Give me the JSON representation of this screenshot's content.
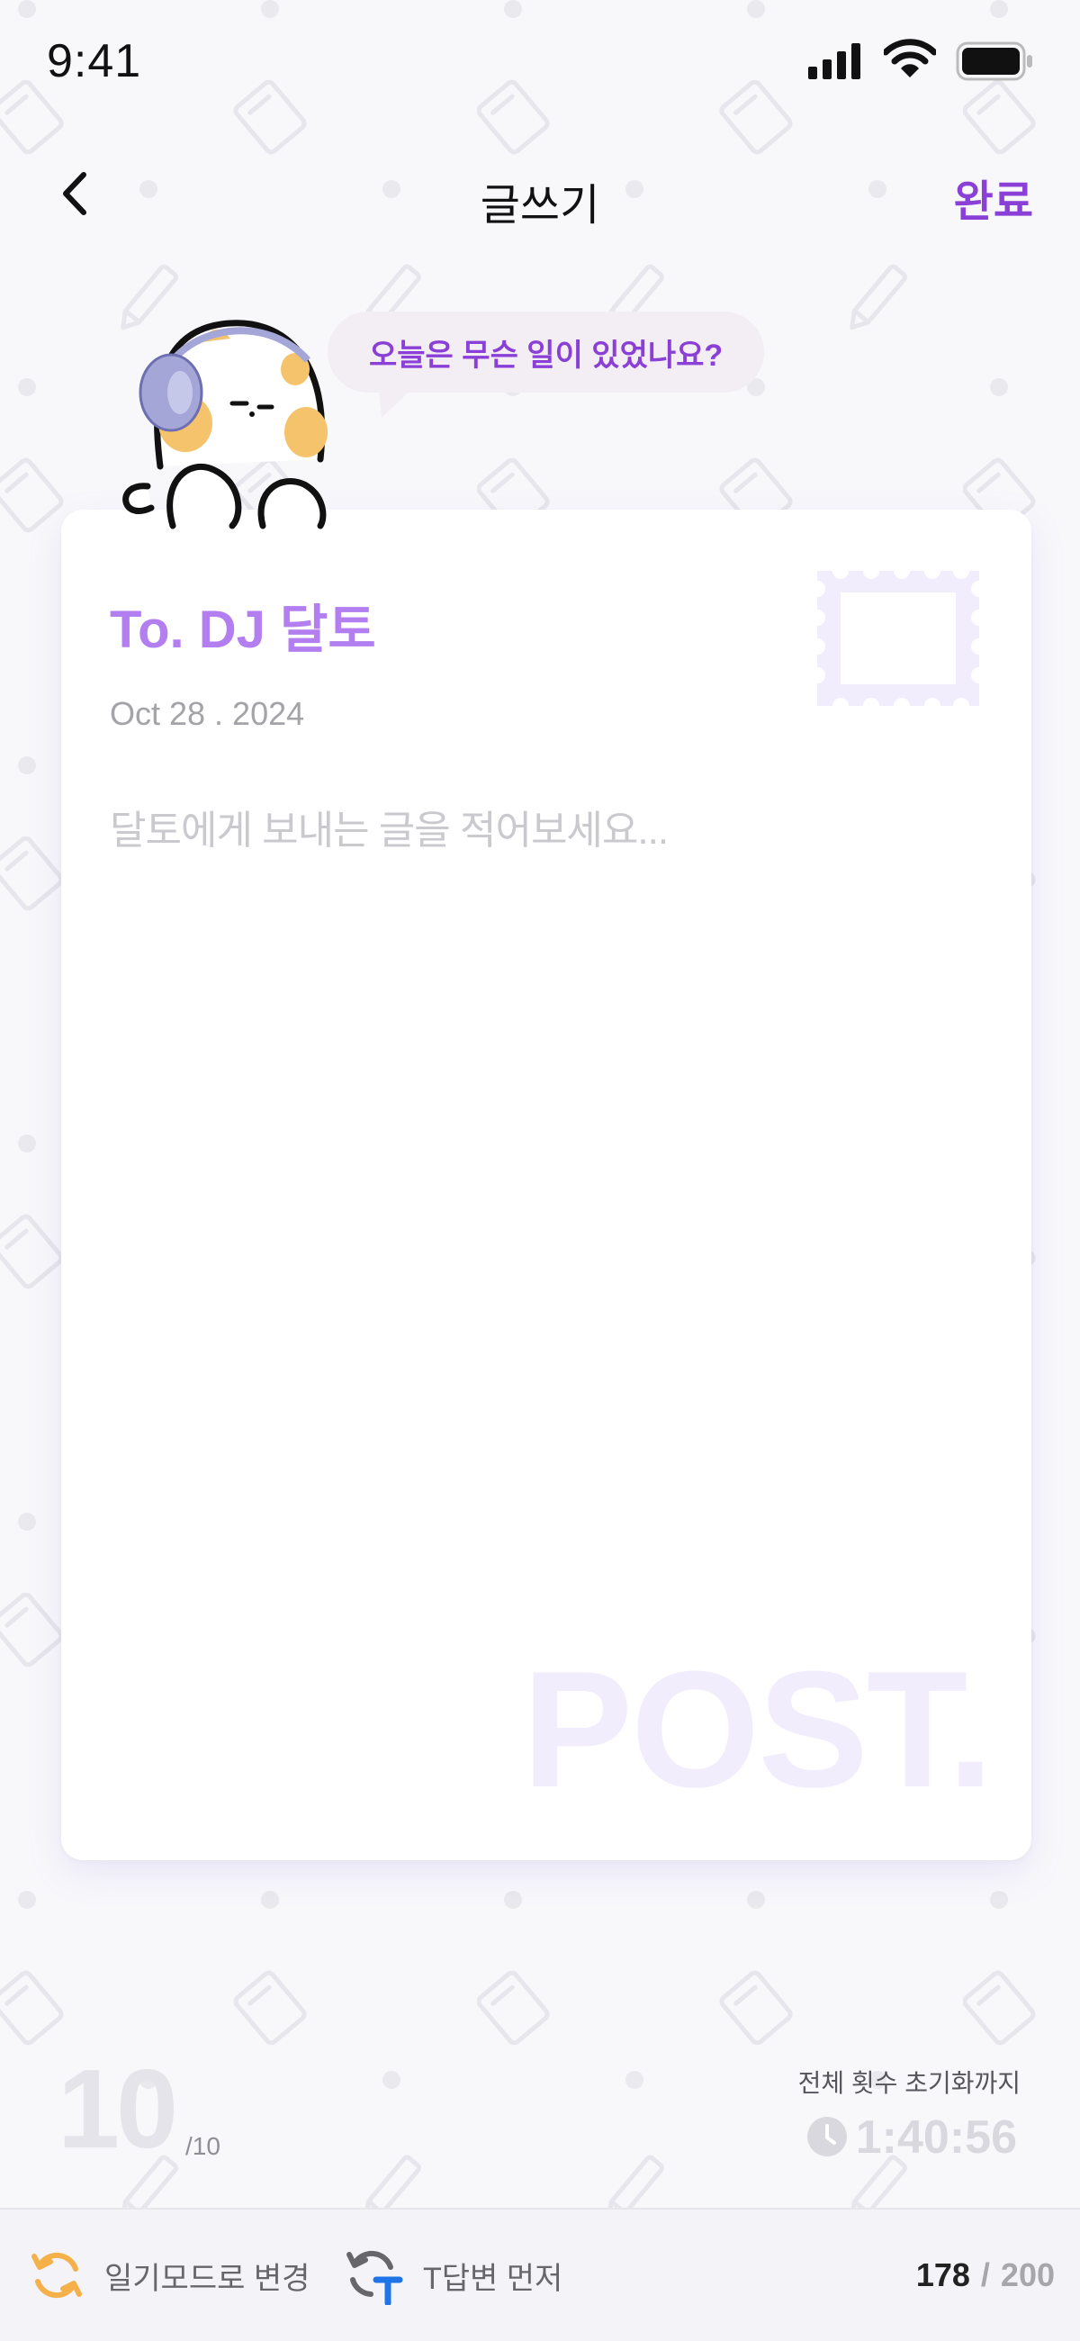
{
  "status_bar": {
    "time": "9:41"
  },
  "header": {
    "title": "글쓰기",
    "done_label": "완료"
  },
  "mascot": {
    "speech": "오늘은 무슨 일이 있었나요?"
  },
  "letter": {
    "recipient": "To. DJ 달토",
    "date": "Oct 28 . 2024",
    "placeholder": "달토에게 보내는 글을 적어보세요...",
    "watermark": "POST."
  },
  "quota": {
    "remaining": "10",
    "total": "/10",
    "reset_label": "전체 횟수 초기화까지",
    "reset_timer": "1:40:56"
  },
  "toolbar": {
    "diary_mode_label": "일기모드로 변경",
    "t_answer_label": "T답변 먼저",
    "char_current": "178",
    "char_separator": "/",
    "char_max": "200"
  },
  "colors": {
    "accent": "#8a3fd6",
    "recipient": "#b27ef0",
    "background": "#f8f8fb",
    "toolbar_bg": "#f3f3f8",
    "diary_icon": "#f5b049",
    "t_icon_badge": "#1f74e8"
  },
  "icons": {
    "back": "chevron-left-icon",
    "signal": "cellular-signal-icon",
    "wifi": "wifi-icon",
    "battery": "battery-icon",
    "stamp": "stamp-icon",
    "clock": "clock-icon",
    "diary_mode": "refresh-icon",
    "t_answer": "t-refresh-icon"
  }
}
